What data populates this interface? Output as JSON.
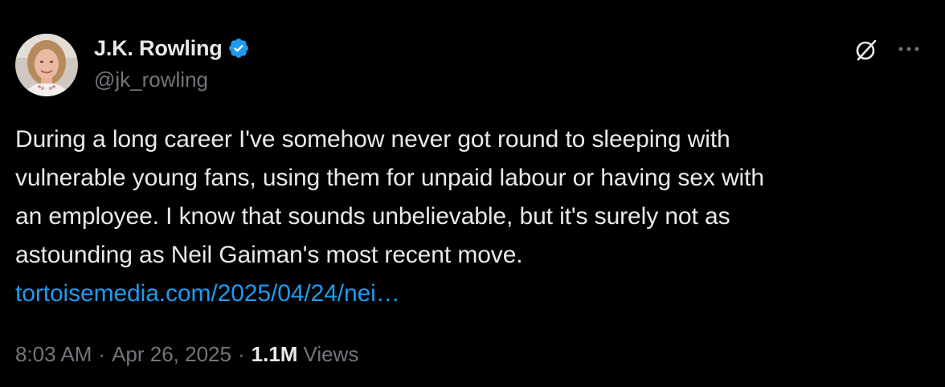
{
  "author": {
    "display_name": "J.K. Rowling",
    "handle": "@jk_rowling",
    "verified": true,
    "verified_color": "#1d9bf0"
  },
  "header_actions": {
    "grok_icon": "slashed-circle-icon",
    "more_icon": "ellipsis-icon"
  },
  "tweet": {
    "text": "During a long career I've somehow never got round to sleeping with\nvulnerable young fans, using them for unpaid labour or having sex with\nan employee. I know that sounds unbelievable, but it's surely not as\nastounding as Neil Gaiman's most recent move.\n",
    "link_text": "tortoisemedia.com/2025/04/24/nei…",
    "link_color": "#1d9bf0"
  },
  "meta": {
    "time": "8:03 AM",
    "separator": "·",
    "date": "Apr 26, 2025",
    "views_count": "1.1M",
    "views_label": "Views"
  },
  "colors": {
    "background": "#000000",
    "primary_text": "#e7e9ea",
    "secondary_text": "#71767b"
  }
}
